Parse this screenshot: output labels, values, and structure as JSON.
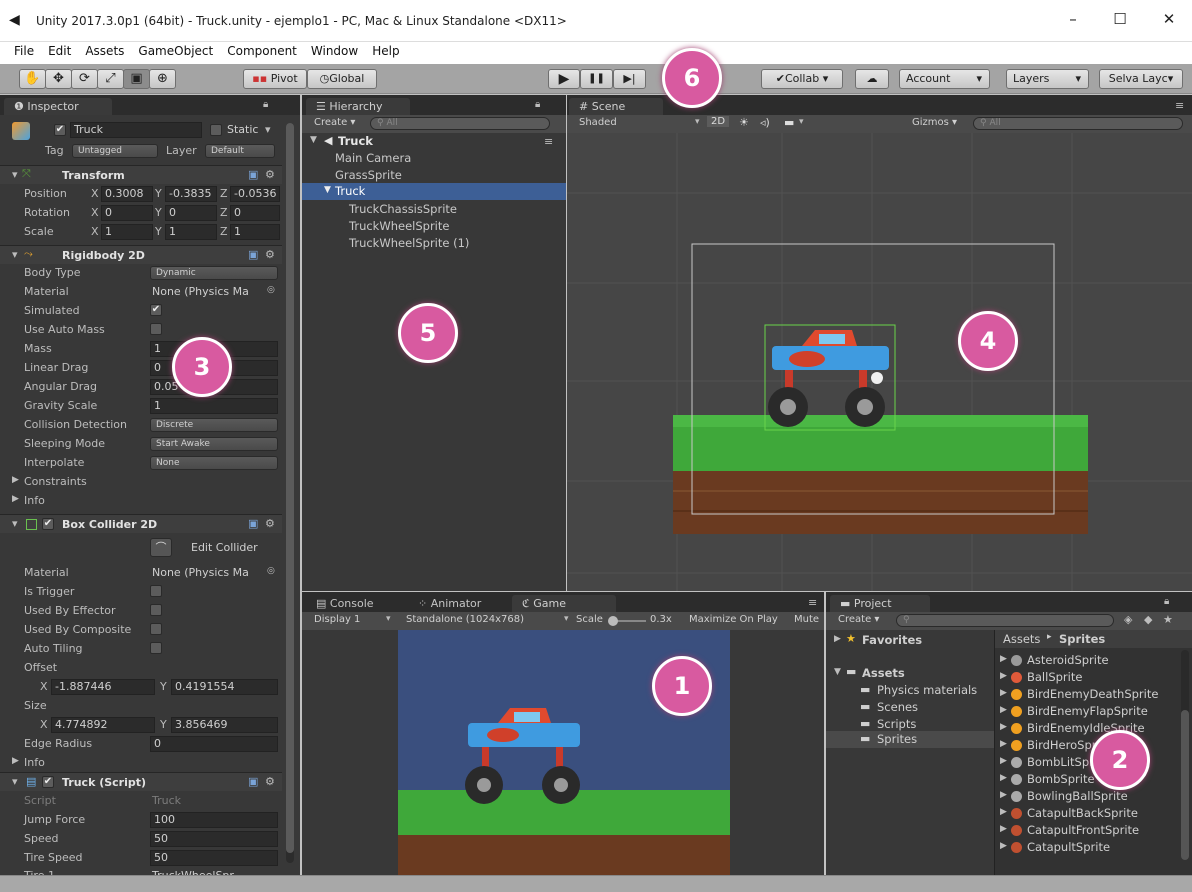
{
  "window": {
    "title": "Unity 2017.3.0p1 (64bit) - Truck.unity - ejemplo1 - PC, Mac & Linux Standalone <DX11>",
    "minimize": "–",
    "maximize": "☐",
    "close": "✕"
  },
  "menu": [
    "File",
    "Edit",
    "Assets",
    "GameObject",
    "Component",
    "Window",
    "Help"
  ],
  "toolbar": {
    "tools": [
      "✋",
      "✥",
      "⟳",
      "⤢",
      "▣",
      "⊕"
    ],
    "pivot": "Pivot",
    "global": "Global",
    "play": "▶",
    "pause": "❚❚",
    "step": "▶|",
    "collab": "Collab ▾",
    "cloud": "☁",
    "account": "Account",
    "layers": "Layers",
    "layout": "Selva Layc▾"
  },
  "inspector": {
    "tab": "Inspector",
    "object_name": "Truck",
    "static": "Static",
    "tag_label": "Tag",
    "tag_value": "Untagged",
    "layer_label": "Layer",
    "layer_value": "Default",
    "transform": {
      "title": "Transform",
      "position_label": "Position",
      "position": {
        "x": "0.3008",
        "y": "-0.3835",
        "z": "-0.0536"
      },
      "rotation_label": "Rotation",
      "rotation": {
        "x": "0",
        "y": "0",
        "z": "0"
      },
      "scale_label": "Scale",
      "scale": {
        "x": "1",
        "y": "1",
        "z": "1"
      }
    },
    "rigidbody": {
      "title": "Rigidbody 2D",
      "body_type_label": "Body Type",
      "body_type": "Dynamic",
      "material_label": "Material",
      "material": "None (Physics Ma",
      "simulated_label": "Simulated",
      "use_auto_mass_label": "Use Auto Mass",
      "mass_label": "Mass",
      "mass": "1",
      "linear_drag_label": "Linear Drag",
      "linear_drag": "0",
      "angular_drag_label": "Angular Drag",
      "angular_drag": "0.05",
      "gravity_label": "Gravity Scale",
      "gravity": "1",
      "collision_label": "Collision Detection",
      "collision": "Discrete",
      "sleeping_label": "Sleeping Mode",
      "sleeping": "Start Awake",
      "interpolate_label": "Interpolate",
      "interpolate": "None",
      "constraints_label": "Constraints",
      "info_label": "Info"
    },
    "box_collider": {
      "title": "Box Collider 2D",
      "edit_collider": "Edit Collider",
      "material_label": "Material",
      "material": "None (Physics Ma",
      "is_trigger_label": "Is Trigger",
      "used_effector_label": "Used By Effector",
      "used_composite_label": "Used By Composite",
      "auto_tiling_label": "Auto Tiling",
      "offset_label": "Offset",
      "offset_x": "-1.887446",
      "offset_y": "0.4191554",
      "size_label": "Size",
      "size_x": "4.774892",
      "size_y": "3.856469",
      "edge_radius_label": "Edge Radius",
      "edge_radius": "0",
      "info_label": "Info"
    },
    "script": {
      "title": "Truck (Script)",
      "script_label": "Script",
      "script_value": "Truck",
      "jump_label": "Jump Force",
      "jump": "100",
      "speed_label": "Speed",
      "speed": "50",
      "tire_speed_label": "Tire Speed",
      "tire_speed": "50",
      "tire1_label": "Tire 1",
      "tire1": "TruckWheelSpr"
    }
  },
  "hierarchy": {
    "tab": "Hierarchy",
    "create": "Create ▾",
    "search_placeholder": "All",
    "scene": "Truck",
    "items": [
      "Main Camera",
      "GrassSprite",
      "Truck",
      "TruckChassisSprite",
      "TruckWheelSprite",
      "TruckWheelSprite (1)"
    ]
  },
  "scene": {
    "tab": "Scene",
    "shaded": "Shaded",
    "mode_2d": "2D",
    "gizmos": "Gizmos ▾",
    "search_placeholder": "All"
  },
  "bottom_tabs": {
    "console": "Console",
    "animator": "Animator",
    "game": "Game"
  },
  "game": {
    "display": "Display 1",
    "resolution": "Standalone (1024x768)",
    "scale_label": "Scale",
    "scale_value": "0.3x",
    "maximize": "Maximize On Play",
    "mute": "Mute"
  },
  "project": {
    "tab": "Project",
    "create": "Create ▾",
    "favorites": "Favorites",
    "assets": "Assets",
    "folders": [
      "Physics materials",
      "Scenes",
      "Scripts",
      "Sprites"
    ],
    "breadcrumb_root": "Assets",
    "breadcrumb_sep": "▸",
    "breadcrumb_current": "Sprites",
    "sprites": [
      "AsteroidSprite",
      "BallSprite",
      "BirdEnemyDeathSprite",
      "BirdEnemyFlapSprite",
      "BirdEnemyIdleSprite",
      "BirdHeroSprite",
      "BombLitSprite",
      "BombSprite",
      "BowlingBallSprite",
      "CatapultBackSprite",
      "CatapultFrontSprite",
      "CatapultSprite"
    ]
  },
  "badges": [
    "1",
    "2",
    "3",
    "4",
    "5",
    "6"
  ],
  "colors": {
    "badge": "#d85aa0",
    "panel": "#383838",
    "selected": "#3d5f96",
    "sky": "#3a4f7e",
    "grass": "#3fa83a",
    "dirt": "#6a3a20"
  }
}
